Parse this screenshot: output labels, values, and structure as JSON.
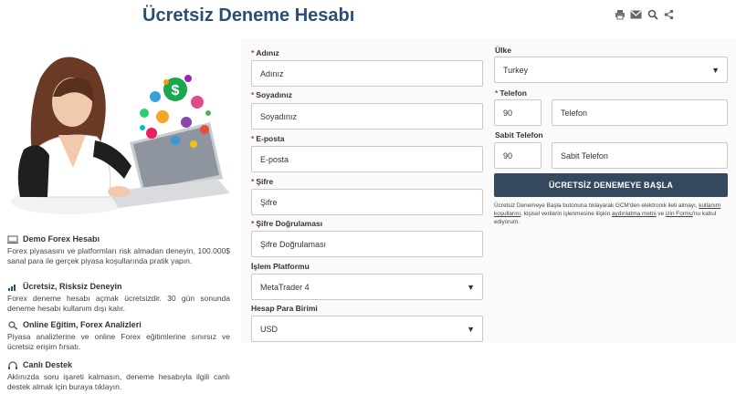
{
  "page": {
    "title": "Ücretsiz Deneme Hesabı"
  },
  "toolbar": {
    "icons": [
      "print-icon",
      "mail-icon",
      "search-icon",
      "share-icon"
    ]
  },
  "features": [
    {
      "title": "Demo Forex Hesabı",
      "text": "Forex piyasasını ve platformları risk almadan deneyin, 100.000$ sanal para ile gerçek piyasa koşullarında pratik yapın.",
      "icon": "demo-icon"
    },
    {
      "title": "Ücretsiz, Risksiz Deneyin",
      "text": "Forex deneme hesabı açmak ücretsizdir. 30 gün sonunda deneme hesabı kullanım dışı kalır.",
      "icon": "chart-icon"
    },
    {
      "title": "Online Eğitim, Forex Analizleri",
      "text": "Piyasa analizlerine ve online Forex eğitimlerine sınırsız ve ücretsiz erişim fırsatı.",
      "icon": "education-icon"
    },
    {
      "title": "Canlı Destek",
      "text": "Aklınızda soru işareti kalmasın, deneme hesabıyla ilgili canlı destek almak için buraya tıklayın.",
      "icon": "headset-icon"
    }
  ],
  "form": {
    "name": {
      "label": "Adınız",
      "placeholder": "Adınız"
    },
    "surname": {
      "label": "Soyadınız",
      "placeholder": "Soyadınız"
    },
    "email": {
      "label": "E-posta",
      "placeholder": "E-posta"
    },
    "password": {
      "label": "Şifre",
      "placeholder": "Şifre"
    },
    "password_confirm": {
      "label": "Şifre Doğrulaması",
      "placeholder": "Şifre Doğrulaması"
    },
    "platform": {
      "label": "İşlem Platformu",
      "value": "MetaTrader 4"
    },
    "currency": {
      "label": "Hesap Para Birimi",
      "value": "USD"
    },
    "country": {
      "label": "Ülke",
      "value": "Turkey"
    },
    "phone": {
      "label": "Telefon",
      "code": "90",
      "placeholder": "Telefon"
    },
    "landline": {
      "label": "Sabit Telefon",
      "code": "90",
      "placeholder": "Sabit Telefon"
    },
    "submit_label": "ÜCRETSİZ DENEMEYE BAŞLA",
    "required_mark": "*"
  },
  "disclaimer": {
    "part1": "Ücretsiz Denemeye Başla butonuna tıklayarak GCM'den elektronik ileti almayı,",
    "link1": "kullanım koşullarını",
    "part2": ", kişisel verilerin işlenmesine ilişkin",
    "link2": "aydınlatma metni",
    "part3": "ve",
    "link3": "izin Formu",
    "part4": "'nu kabul ediyorum."
  },
  "colors": {
    "title": "#2b4f73",
    "button": "#34495e",
    "required": "#c0392b"
  }
}
